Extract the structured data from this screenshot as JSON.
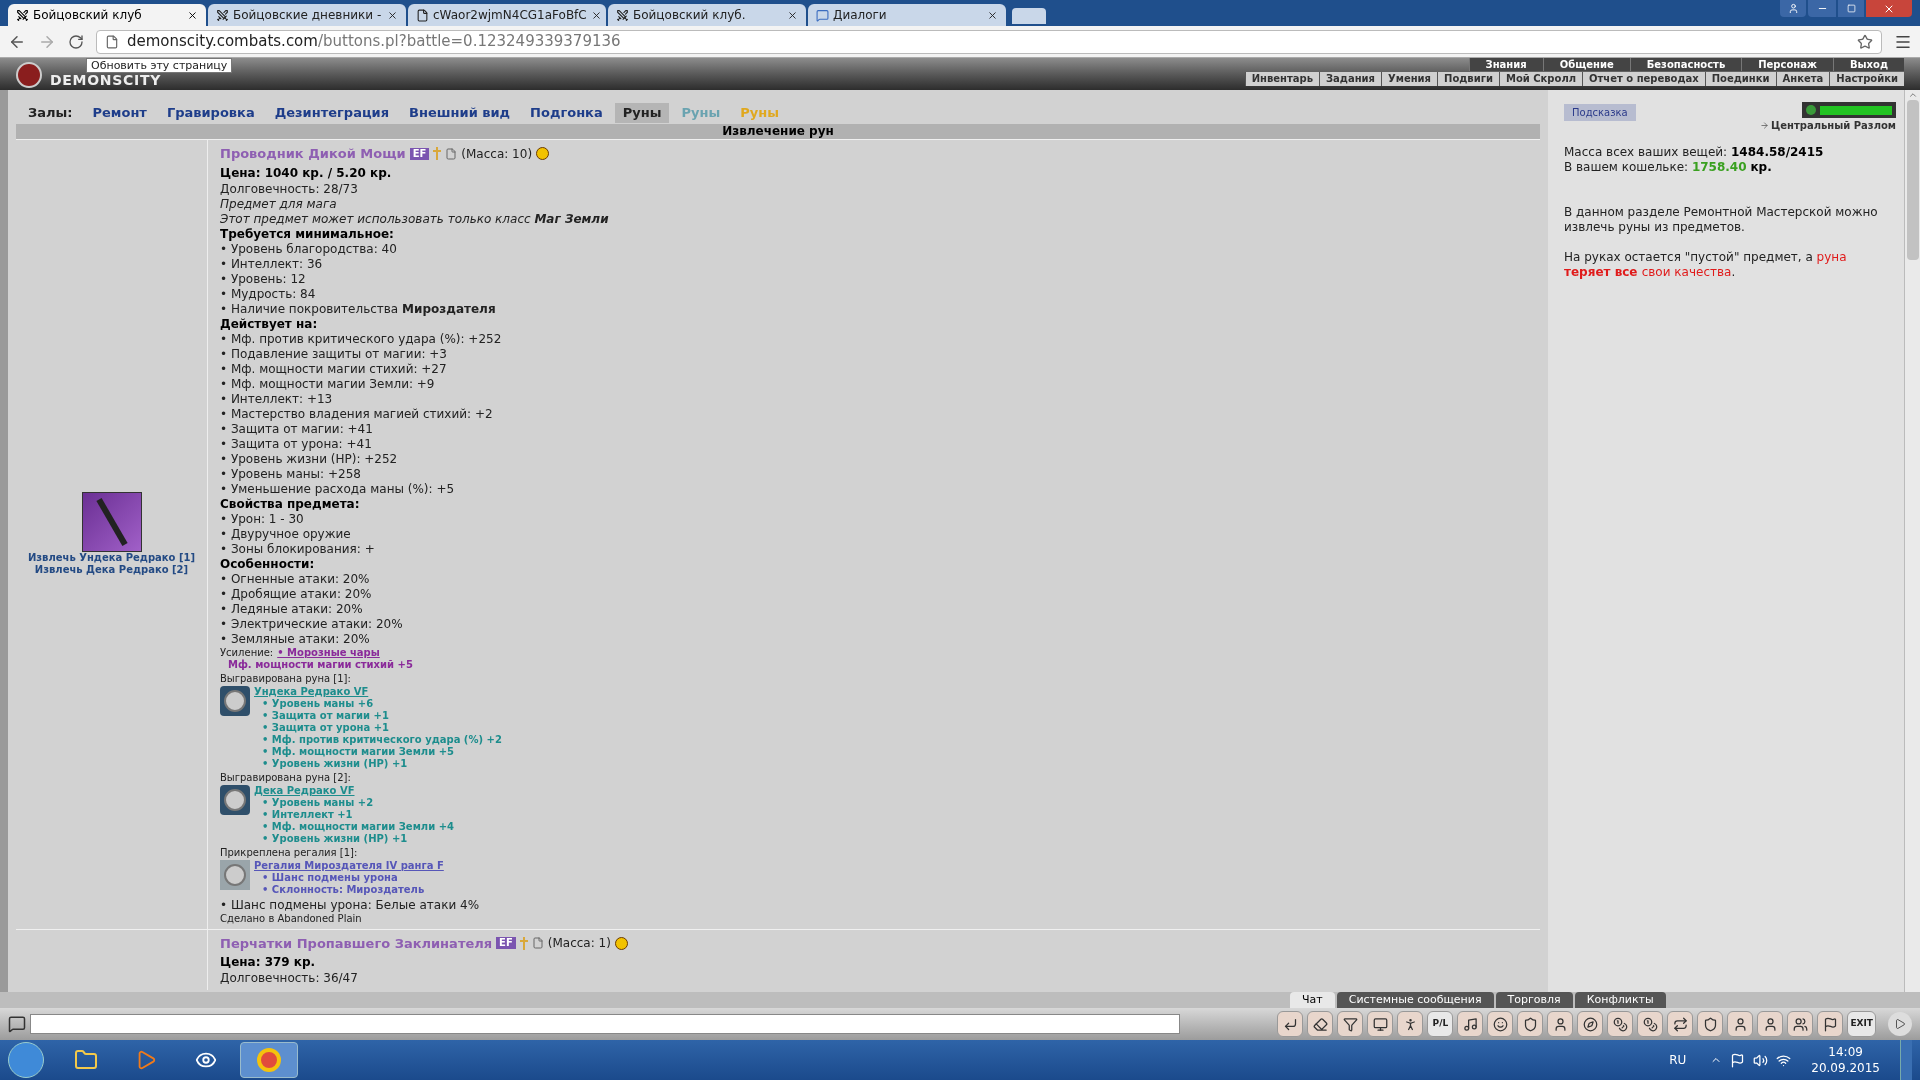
{
  "browser": {
    "tabs": [
      {
        "title": "Бойцовский клуб",
        "selected": true
      },
      {
        "title": "Бойцовские дневники -",
        "selected": false
      },
      {
        "title": "cWaor2wjmN4CG1aFoBfC",
        "selected": false
      },
      {
        "title": "Бойцовский клуб.",
        "selected": false
      },
      {
        "title": "Диалоги",
        "selected": false
      }
    ],
    "url_host": "demonscity.combats.com",
    "url_path": "/buttons.pl?battle=0.123249339379136",
    "tooltip": "Обновить эту страницу"
  },
  "game_header": {
    "logo": "DEMONSCITY",
    "top_menu": [
      "Знания",
      "Общение",
      "Безопасность",
      "Персонаж",
      "Выход"
    ],
    "sub_menu": [
      "Инвентарь",
      "Задания",
      "Умения",
      "Подвиги",
      "Мой Скролл",
      "Отчет о переводах",
      "Поединки",
      "Анкета",
      "Настройки"
    ]
  },
  "halls": {
    "label": "Залы:",
    "items": [
      {
        "label": "Ремонт",
        "selected": false,
        "color": "#1e3d8a"
      },
      {
        "label": "Гравировка",
        "selected": false,
        "color": "#1e3d8a"
      },
      {
        "label": "Дезинтеграция",
        "selected": false,
        "color": "#1e3d8a"
      },
      {
        "label": "Внешний вид",
        "selected": false,
        "color": "#1e3d8a"
      },
      {
        "label": "Подгонка",
        "selected": false,
        "color": "#1e3d8a"
      },
      {
        "label": "Руны",
        "selected": true,
        "color": "#222222"
      },
      {
        "label": "Руны",
        "selected": false,
        "color": "#6aa3b0"
      },
      {
        "label": "Руны",
        "selected": false,
        "color": "#e0a81e"
      }
    ]
  },
  "section_title": "Извлечение рун",
  "items": [
    {
      "name": "Проводник Дикой Мощи",
      "badge": "EF",
      "mass": "(Масса: 10)",
      "price": "Цена: 1040 кр. / 5.20 кр.",
      "extract_links": [
        "Извлечь Ундека Редрако [1]",
        "Извлечь Дека Редрако [2]"
      ],
      "lines": [
        {
          "kind": "plain",
          "text": "Долговечность: 28/73"
        },
        {
          "kind": "italic",
          "text": "Предмет для мага"
        },
        {
          "kind": "italic",
          "text": "Этот предмет может использовать только класс **Маг Земли**"
        },
        {
          "kind": "heading",
          "text": "Требуется минимальное:"
        },
        {
          "kind": "plain",
          "text": "• Уровень благородства: 40"
        },
        {
          "kind": "plain",
          "text": "• Интеллект: 36"
        },
        {
          "kind": "plain",
          "text": "• Уровень: 12"
        },
        {
          "kind": "plain",
          "text": "• Мудрость: 84"
        },
        {
          "kind": "plain",
          "text": "• Наличие покровительства **Мироздателя**"
        },
        {
          "kind": "heading",
          "text": "Действует на:"
        },
        {
          "kind": "plain",
          "text": "• Мф. против критического удара (%): +252"
        },
        {
          "kind": "plain",
          "text": "• Подавление защиты от магии: +3"
        },
        {
          "kind": "plain",
          "text": "• Мф. мощности магии стихий: +27"
        },
        {
          "kind": "plain",
          "text": "• Мф. мощности магии Земли: +9"
        },
        {
          "kind": "plain",
          "text": "• Интеллект: +13"
        },
        {
          "kind": "plain",
          "text": "• Мастерство владения магией стихий: +2"
        },
        {
          "kind": "plain",
          "text": "• Защита от магии: +41"
        },
        {
          "kind": "plain",
          "text": "• Защита от урона: +41"
        },
        {
          "kind": "plain",
          "text": "• Уровень жизни (HP): +252"
        },
        {
          "kind": "plain",
          "text": "• Уровень маны: +258"
        },
        {
          "kind": "plain",
          "text": "• Уменьшение расхода маны (%): +5"
        },
        {
          "kind": "heading",
          "text": "Свойства предмета:"
        },
        {
          "kind": "plain",
          "text": "• Урон: 1 - 30"
        },
        {
          "kind": "plain",
          "text": "• Двуручное оружие"
        },
        {
          "kind": "plain",
          "text": "• Зоны блокирования: +"
        },
        {
          "kind": "heading",
          "text": "Особенности:"
        },
        {
          "kind": "plain",
          "text": "• Огненные атаки: 20%"
        },
        {
          "kind": "plain",
          "text": "• Дробящие атаки: 20%"
        },
        {
          "kind": "plain",
          "text": "• Ледяные атаки: 20%"
        },
        {
          "kind": "plain",
          "text": "• Электрические атаки: 20%"
        },
        {
          "kind": "plain",
          "text": "• Земляные атаки: 20%"
        }
      ],
      "enhancement": {
        "label": "Усиление:",
        "name": "• Морозные чары",
        "effect": "Мф. мощности магии стихий +5"
      },
      "inserts": [
        {
          "kind": "rune",
          "label": "Выгравирована руна [1]:",
          "name": "Ундека Редрако VF",
          "stats": [
            "• Уровень маны +6",
            "• Защита от магии +1",
            "• Защита от урона +1",
            "• Мф. против критического удара (%) +2",
            "• Мф. мощности магии Земли +5",
            "• Уровень жизни (HP) +1"
          ]
        },
        {
          "kind": "rune",
          "label": "Выгравирована руна [2]:",
          "name": "Дека Редрако VF",
          "stats": [
            "• Уровень маны +2",
            "• Интеллект +1",
            "• Мф. мощности магии Земли +4",
            "• Уровень жизни (HP) +1"
          ]
        },
        {
          "kind": "regalia",
          "label": "Прикреплена регалия [1]:",
          "name": "Регалия Мироздателя IV ранга F",
          "stats": [
            "• Шанс подмены урона",
            "• Склонность: Мироздатель"
          ]
        }
      ],
      "footer": [
        "• Шанс подмены урона: Белые атаки 4%"
      ],
      "made_in": "Сделано в Abandoned Plain"
    },
    {
      "name": "Перчатки Пропавшего Заклинателя",
      "badge": "EF",
      "mass": "(Масса: 1)",
      "price": "Цена: 379 кр.",
      "lines": [
        {
          "kind": "plain",
          "text": "Долговечность: 36/47"
        }
      ]
    }
  ],
  "side": {
    "hint": "Подсказка",
    "location": "Центральный Разлом",
    "mass_label": "Масса всех ваших вещей:",
    "mass_value": "1484.58/2415",
    "purse_label": "В вашем кошельке:",
    "purse_value": "1758.40",
    "purse_unit": "кр.",
    "info": "В данном разделе Ремонтной Мастерской можно извлечь руны из предметов.",
    "warning": [
      {
        "kind": "plain",
        "text": "На руках остается \"пустой\" предмет, а "
      },
      {
        "kind": "warn",
        "text": "руна"
      },
      {
        "kind": "warn_bold",
        "text": "теряет все"
      },
      {
        "kind": "warn",
        "text": "свои качества"
      },
      {
        "kind": "plain",
        "text": "."
      }
    ]
  },
  "chat": {
    "tabs": [
      {
        "label": "Чат",
        "selected": true
      },
      {
        "label": "Системные сообщения",
        "selected": false
      },
      {
        "label": "Торговля",
        "selected": false
      },
      {
        "label": "Конфликты",
        "selected": false
      }
    ],
    "toolbar_labels": [
      "P/L",
      "EXIT"
    ]
  },
  "taskbar": {
    "lang": "RU",
    "time": "14:09",
    "date": "20.09.2015"
  }
}
